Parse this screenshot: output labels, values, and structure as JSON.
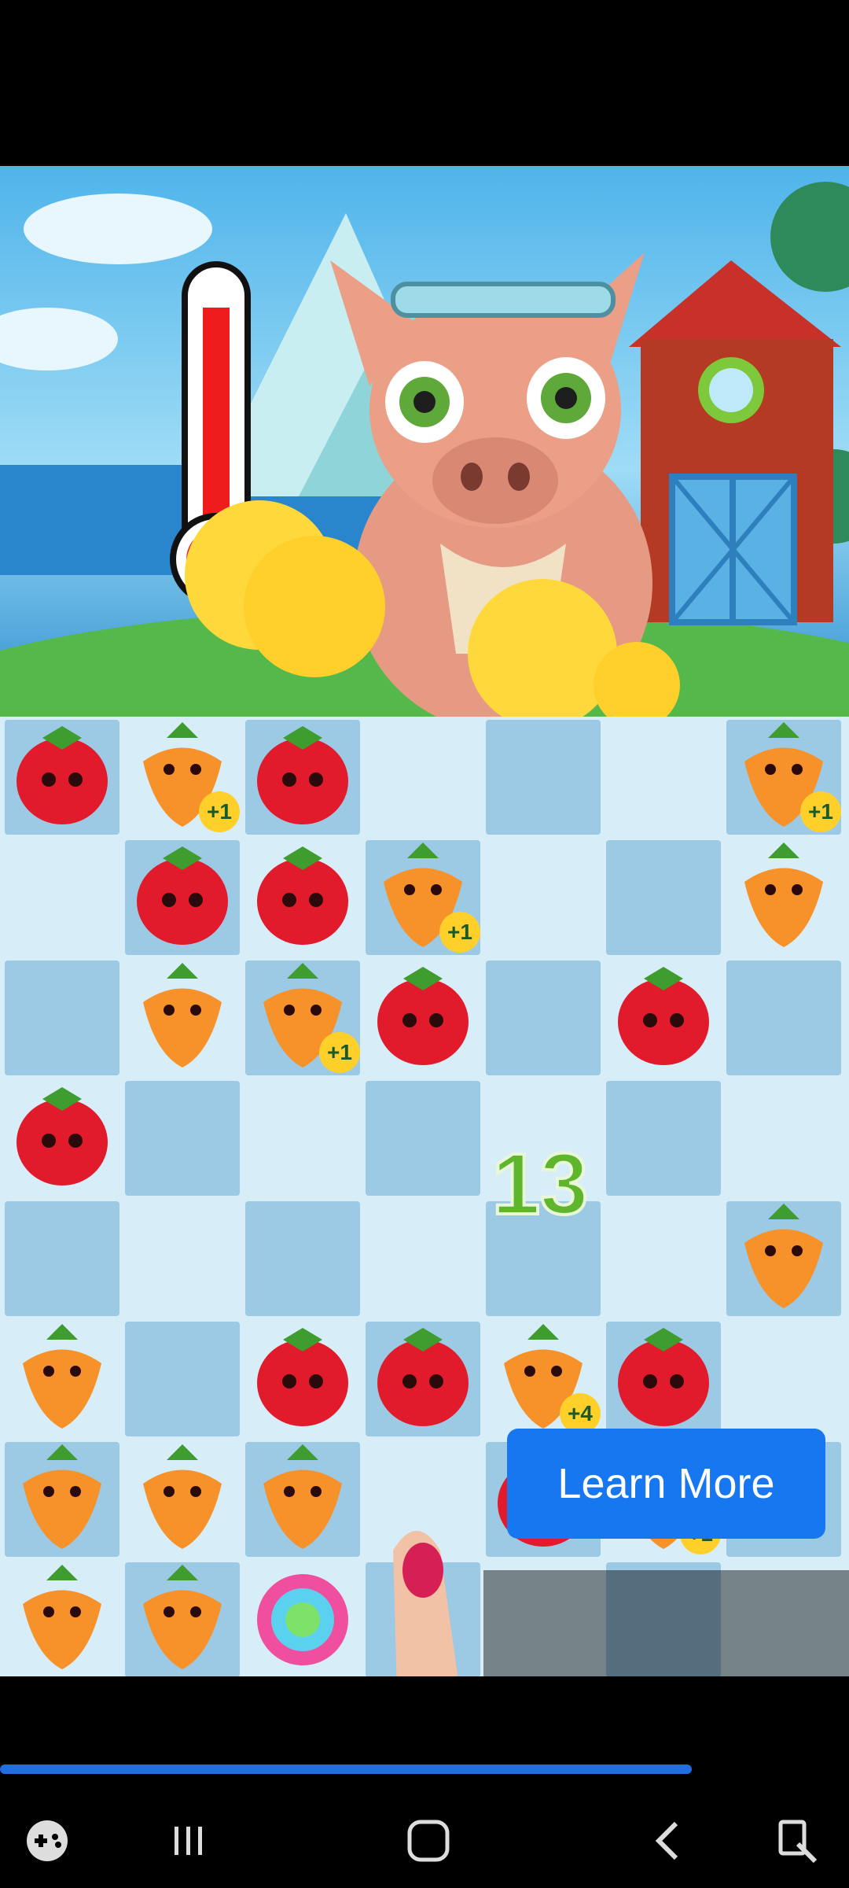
{
  "ad": {
    "cta_label": "Learn More",
    "progress": 0.815
  },
  "game": {
    "move_popup": "13",
    "bonus_badges": [
      "+1",
      "+1",
      "+1",
      "+1",
      "+4",
      "+1"
    ],
    "thermometer_fill": 0.85
  },
  "icons": {
    "game_controller": "gamepad-icon",
    "recents": "recents-icon",
    "home": "home-icon",
    "back": "back-icon",
    "screenshot": "screenshot-icon"
  },
  "colors": {
    "cta": "#1677f0",
    "progress": "#1f6fe0",
    "board_tile": "#9cc9e3"
  }
}
